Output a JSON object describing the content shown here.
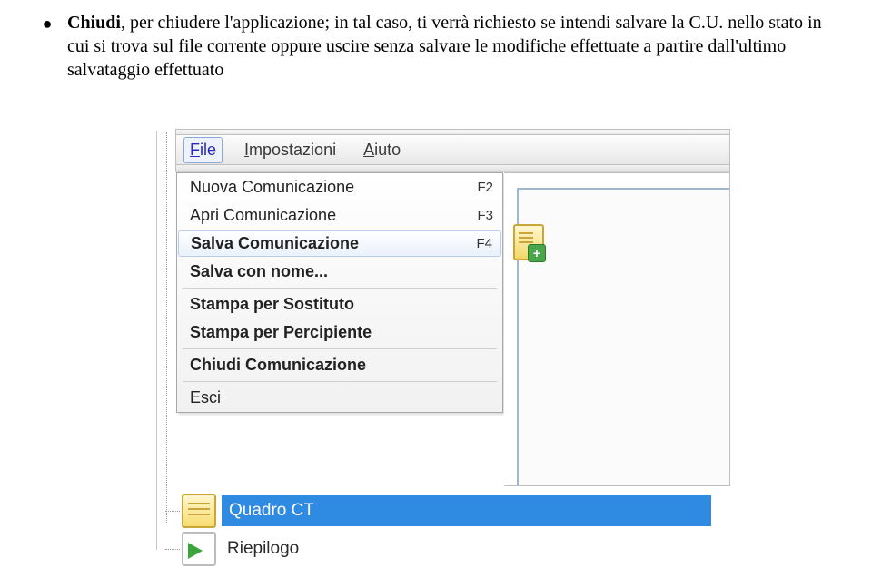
{
  "bullet": {
    "lead": "Chiudi",
    "cont1": ", per chiudere l'applicazione; in tal caso, ti verrà richiesto se intendi salvare la C.U. nello stato in cui si trova sul file corrente oppure uscire senza salvare le modifiche effettuate a partire dall'ultimo salvataggio effettuato"
  },
  "menubar": {
    "file": "File",
    "impostazioni": "Impostazioni",
    "aiuto": "Aiuto"
  },
  "menu": {
    "nuova": {
      "label": "Nuova Comunicazione",
      "key": "F2"
    },
    "apri": {
      "label": "Apri Comunicazione",
      "key": "F3"
    },
    "salva": {
      "label": "Salva Comunicazione",
      "key": "F4"
    },
    "salva_nome": {
      "label": "Salva con nome..."
    },
    "stampa_sost": {
      "label": "Stampa per Sostituto"
    },
    "stampa_perc": {
      "label": "Stampa per Percipiente"
    },
    "chiudi_comm": {
      "label": "Chiudi Comunicazione"
    },
    "esci": {
      "label": "Esci"
    }
  },
  "tree": {
    "quadro_ct": "Quadro CT",
    "riepilogo": "Riepilogo"
  }
}
